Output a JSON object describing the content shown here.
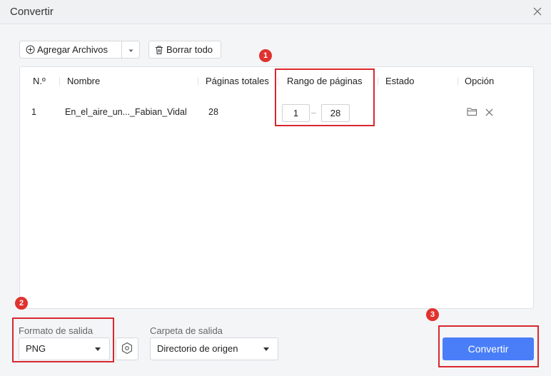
{
  "window": {
    "title": "Convertir"
  },
  "toolbar": {
    "add_files_label": "Agregar Archivos",
    "clear_all_label": "Borrar todo"
  },
  "table": {
    "columns": [
      "N.º",
      "Nombre",
      "Páginas totales",
      "Rango de páginas",
      "Estado",
      "Opción"
    ],
    "rows": [
      {
        "index": "1",
        "name": "En_el_aire_un..._Fabian_Vidal",
        "total_pages": "28",
        "range_from": "1",
        "range_to": "28",
        "status": ""
      }
    ]
  },
  "badges": {
    "one": "1",
    "two": "2",
    "three": "3"
  },
  "output_format": {
    "label": "Formato de salida",
    "value": "PNG"
  },
  "output_folder": {
    "label": "Carpeta de salida",
    "value": "Directorio de origen"
  },
  "convert_button": {
    "label": "Convertir"
  },
  "colors": {
    "accent": "#4a7ef8",
    "highlight": "#d9282f"
  }
}
